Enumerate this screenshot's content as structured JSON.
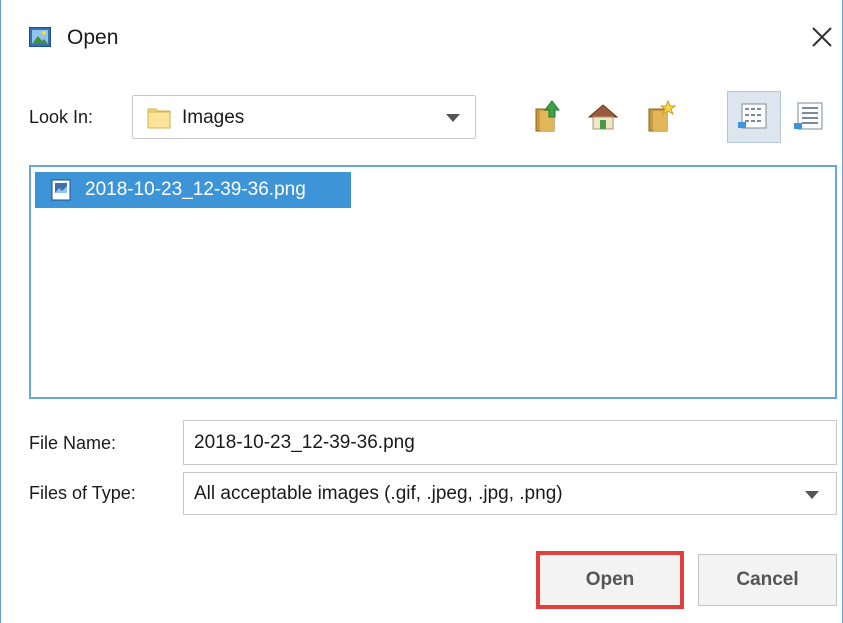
{
  "window": {
    "title": "Open",
    "title_icon": "image-icon",
    "close_icon": "close-icon"
  },
  "lookin": {
    "label": "Look In:",
    "value": "Images",
    "folder_icon": "folder-icon"
  },
  "toolbar": {
    "up": "up-folder-icon",
    "home": "home-icon",
    "new_folder": "new-folder-icon",
    "list_view": "list-view-icon",
    "details_view": "details-view-icon"
  },
  "files": [
    {
      "name": "2018-10-23_12-39-36.png",
      "icon": "image-file-icon",
      "selected": true
    }
  ],
  "filename": {
    "label": "File Name:",
    "value": "2018-10-23_12-39-36.png"
  },
  "filetype": {
    "label": "Files of Type:",
    "value": "All acceptable images (.gif, .jpeg, .jpg, .png)"
  },
  "buttons": {
    "open": "Open",
    "cancel": "Cancel"
  },
  "colors": {
    "selection": "#3d95d8",
    "highlight_border": "#e0403e",
    "list_border": "#6aa6dc"
  }
}
